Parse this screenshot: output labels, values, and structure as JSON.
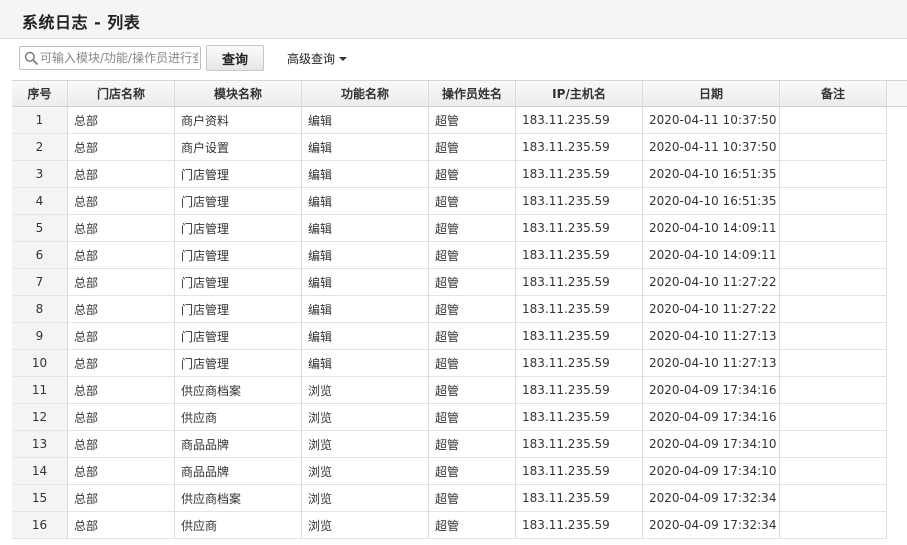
{
  "page": {
    "title": "系统日志 - 列表"
  },
  "toolbar": {
    "search_placeholder": "可输入模块/功能/操作员进行查询",
    "query_label": "查询",
    "advanced_label": "高级查询"
  },
  "table": {
    "columns": [
      "序号",
      "门店名称",
      "模块名称",
      "功能名称",
      "操作员姓名",
      "IP/主机名",
      "日期",
      "备注"
    ],
    "rows": [
      {
        "no": "1",
        "store": "总部",
        "module": "商户资料",
        "func": "编辑",
        "op": "超管",
        "ip": "183.11.235.59",
        "date": "2020-04-11 10:37:50",
        "note": ""
      },
      {
        "no": "2",
        "store": "总部",
        "module": "商户设置",
        "func": "编辑",
        "op": "超管",
        "ip": "183.11.235.59",
        "date": "2020-04-11 10:37:50",
        "note": ""
      },
      {
        "no": "3",
        "store": "总部",
        "module": "门店管理",
        "func": "编辑",
        "op": "超管",
        "ip": "183.11.235.59",
        "date": "2020-04-10 16:51:35",
        "note": ""
      },
      {
        "no": "4",
        "store": "总部",
        "module": "门店管理",
        "func": "编辑",
        "op": "超管",
        "ip": "183.11.235.59",
        "date": "2020-04-10 16:51:35",
        "note": ""
      },
      {
        "no": "5",
        "store": "总部",
        "module": "门店管理",
        "func": "编辑",
        "op": "超管",
        "ip": "183.11.235.59",
        "date": "2020-04-10 14:09:11",
        "note": ""
      },
      {
        "no": "6",
        "store": "总部",
        "module": "门店管理",
        "func": "编辑",
        "op": "超管",
        "ip": "183.11.235.59",
        "date": "2020-04-10 14:09:11",
        "note": ""
      },
      {
        "no": "7",
        "store": "总部",
        "module": "门店管理",
        "func": "编辑",
        "op": "超管",
        "ip": "183.11.235.59",
        "date": "2020-04-10 11:27:22",
        "note": ""
      },
      {
        "no": "8",
        "store": "总部",
        "module": "门店管理",
        "func": "编辑",
        "op": "超管",
        "ip": "183.11.235.59",
        "date": "2020-04-10 11:27:22",
        "note": ""
      },
      {
        "no": "9",
        "store": "总部",
        "module": "门店管理",
        "func": "编辑",
        "op": "超管",
        "ip": "183.11.235.59",
        "date": "2020-04-10 11:27:13",
        "note": ""
      },
      {
        "no": "10",
        "store": "总部",
        "module": "门店管理",
        "func": "编辑",
        "op": "超管",
        "ip": "183.11.235.59",
        "date": "2020-04-10 11:27:13",
        "note": ""
      },
      {
        "no": "11",
        "store": "总部",
        "module": "供应商档案",
        "func": "浏览",
        "op": "超管",
        "ip": "183.11.235.59",
        "date": "2020-04-09 17:34:16",
        "note": ""
      },
      {
        "no": "12",
        "store": "总部",
        "module": "供应商",
        "func": "浏览",
        "op": "超管",
        "ip": "183.11.235.59",
        "date": "2020-04-09 17:34:16",
        "note": ""
      },
      {
        "no": "13",
        "store": "总部",
        "module": "商品品牌",
        "func": "浏览",
        "op": "超管",
        "ip": "183.11.235.59",
        "date": "2020-04-09 17:34:10",
        "note": ""
      },
      {
        "no": "14",
        "store": "总部",
        "module": "商品品牌",
        "func": "浏览",
        "op": "超管",
        "ip": "183.11.235.59",
        "date": "2020-04-09 17:34:10",
        "note": ""
      },
      {
        "no": "15",
        "store": "总部",
        "module": "供应商档案",
        "func": "浏览",
        "op": "超管",
        "ip": "183.11.235.59",
        "date": "2020-04-09 17:32:34",
        "note": ""
      },
      {
        "no": "16",
        "store": "总部",
        "module": "供应商",
        "func": "浏览",
        "op": "超管",
        "ip": "183.11.235.59",
        "date": "2020-04-09 17:32:34",
        "note": ""
      }
    ]
  }
}
